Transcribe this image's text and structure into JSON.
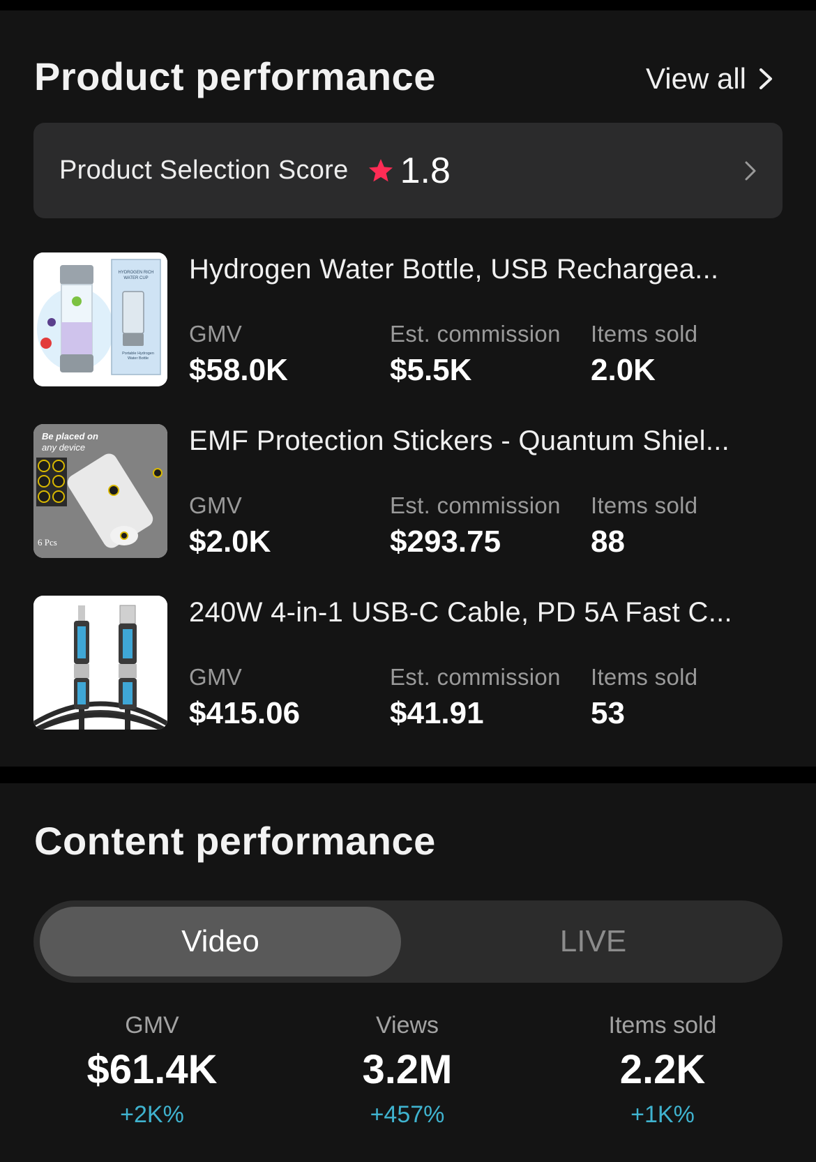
{
  "product_performance": {
    "title": "Product performance",
    "view_all_label": "View all",
    "score": {
      "label": "Product Selection Score",
      "value": "1.8",
      "star_color": "#fe2c55"
    },
    "products": [
      {
        "name": "Hydrogen Water Bottle, USB Rechargea...",
        "thumb_text": [
          "HYDROGEN RICH",
          "WATER CUP",
          "Portable Hydrogen",
          "Water Bottle"
        ],
        "metrics": [
          {
            "label": "GMV",
            "value": "$58.0K"
          },
          {
            "label": "Est. commission",
            "value": "$5.5K"
          },
          {
            "label": "Items sold",
            "value": "2.0K"
          }
        ]
      },
      {
        "name": "EMF Protection Stickers - Quantum Shiel...",
        "thumb_text": [
          "Be placed on",
          "any device",
          "6 Pcs"
        ],
        "metrics": [
          {
            "label": "GMV",
            "value": "$2.0K"
          },
          {
            "label": "Est. commission",
            "value": "$293.75"
          },
          {
            "label": "Items sold",
            "value": "88"
          }
        ]
      },
      {
        "name": "240W 4-in-1 USB-C Cable, PD 5A Fast C...",
        "metrics": [
          {
            "label": "GMV",
            "value": "$415.06"
          },
          {
            "label": "Est. commission",
            "value": "$41.91"
          },
          {
            "label": "Items sold",
            "value": "53"
          }
        ]
      }
    ]
  },
  "content_performance": {
    "title": "Content performance",
    "tabs": [
      {
        "label": "Video",
        "selected": true
      },
      {
        "label": "LIVE",
        "selected": false
      }
    ],
    "stats": [
      {
        "label": "GMV",
        "value": "$61.4K",
        "change": "+2K%"
      },
      {
        "label": "Views",
        "value": "3.2M",
        "change": "+457%"
      },
      {
        "label": "Items sold",
        "value": "2.2K",
        "change": "+1K%"
      }
    ]
  },
  "colors": {
    "background": "#141414",
    "card": "#2b2b2c",
    "accent_positive": "#3fb3cf",
    "star": "#fe2c55"
  }
}
